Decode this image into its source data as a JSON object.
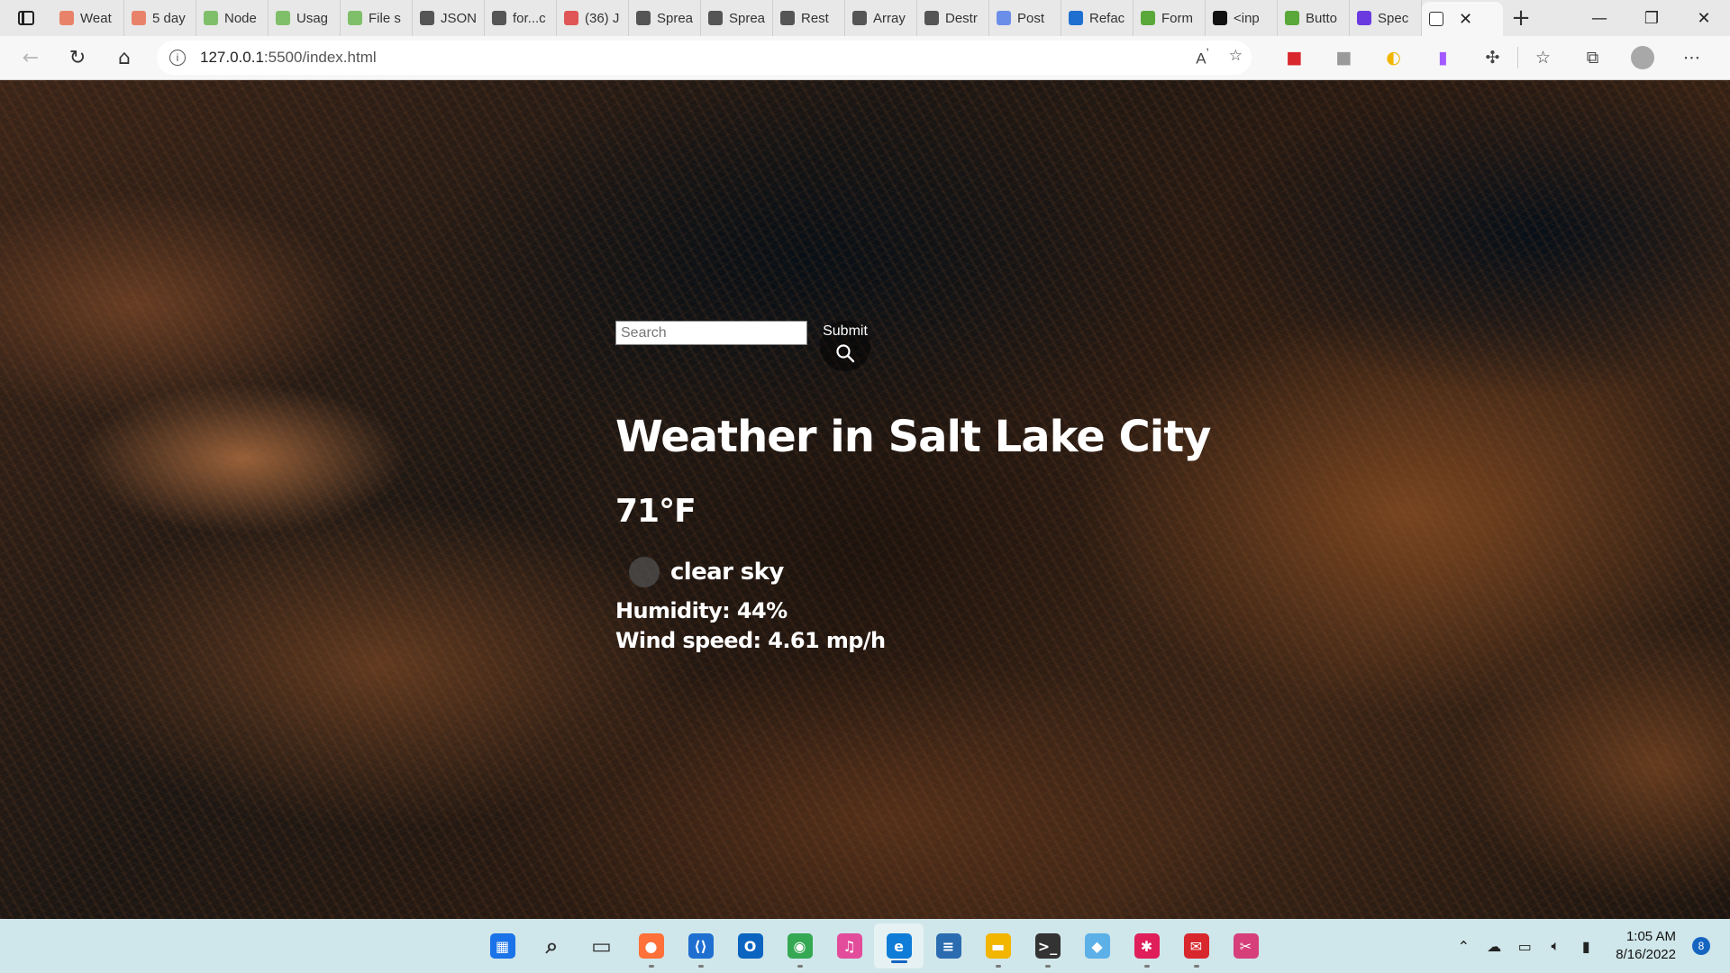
{
  "browser": {
    "tabs": [
      {
        "label": "Weat",
        "icon": "openweather-icon",
        "color": "#e8836a"
      },
      {
        "label": "5 day",
        "icon": "openweather-icon",
        "color": "#e8836a"
      },
      {
        "label": "Node",
        "icon": "nodejs-icon",
        "color": "#7fbf6a"
      },
      {
        "label": "Usag",
        "icon": "nodejs-icon",
        "color": "#7fbf6a"
      },
      {
        "label": "File s",
        "icon": "nodejs-icon",
        "color": "#7fbf6a"
      },
      {
        "label": "JSON",
        "icon": "mdn-icon",
        "color": "#555555"
      },
      {
        "label": "for...c",
        "icon": "mdn-icon",
        "color": "#555555"
      },
      {
        "label": "(36) J",
        "icon": "youtube-icon",
        "color": "#e05555"
      },
      {
        "label": "Sprea",
        "icon": "mdn-icon",
        "color": "#555555"
      },
      {
        "label": "Sprea",
        "icon": "mdn-icon",
        "color": "#555555"
      },
      {
        "label": "Rest",
        "icon": "mdn-icon",
        "color": "#555555"
      },
      {
        "label": "Array",
        "icon": "mdn-icon",
        "color": "#555555"
      },
      {
        "label": "Destr",
        "icon": "mdn-icon",
        "color": "#555555"
      },
      {
        "label": "Post",
        "icon": "zoom-icon",
        "color": "#6b8ee8"
      },
      {
        "label": "Refac",
        "icon": "vscode-icon",
        "color": "#1f6fd1"
      },
      {
        "label": "Form",
        "icon": "green-leaf-icon",
        "color": "#5aa83a"
      },
      {
        "label": "<inp",
        "icon": "mdn-icon",
        "color": "#111111"
      },
      {
        "label": "Butto",
        "icon": "green-leaf-icon",
        "color": "#5aa83a"
      },
      {
        "label": "Spec",
        "icon": "purple-icon",
        "color": "#6a3ae0"
      },
      {
        "label": "",
        "icon": "page-icon",
        "color": "#ffffff",
        "active": true
      }
    ],
    "window_controls": {
      "minimize": "—",
      "restore": "❐",
      "close": "✕"
    },
    "url_host": "127.0.0.1",
    "url_path": ":5500/index.html"
  },
  "page": {
    "search": {
      "placeholder": "Search",
      "value": ""
    },
    "submit_label": "Submit",
    "title": "Weather in Salt Lake City",
    "temperature": "71°F",
    "description": "clear sky",
    "humidity": "Humidity: 44%",
    "wind": "Wind speed: 4.61 mp/h"
  },
  "taskbar": {
    "apps": [
      {
        "name": "start-icon",
        "color": "#1a73e8",
        "glyph": "▦"
      },
      {
        "name": "search-icon",
        "color": "#333333",
        "glyph": "⌕"
      },
      {
        "name": "task-view-icon",
        "color": "#333333",
        "glyph": "▭"
      },
      {
        "name": "firefox-icon",
        "color": "#ff7139",
        "glyph": "●"
      },
      {
        "name": "vscode-icon",
        "color": "#1f6fd1",
        "glyph": "⟨⟩"
      },
      {
        "name": "outlook-icon",
        "color": "#0a64c0",
        "glyph": "O"
      },
      {
        "name": "chrome-icon",
        "color": "#34a853",
        "glyph": "◉"
      },
      {
        "name": "itunes-icon",
        "color": "#e24c9b",
        "glyph": "♫"
      },
      {
        "name": "edge-icon",
        "color": "#0f7cd8",
        "glyph": "e"
      },
      {
        "name": "notepad-icon",
        "color": "#2b6cb0",
        "glyph": "≡"
      },
      {
        "name": "file-explorer-icon",
        "color": "#f2b500",
        "glyph": "▬"
      },
      {
        "name": "terminal-icon",
        "color": "#333333",
        "glyph": ">_"
      },
      {
        "name": "git-icon",
        "color": "#5cb0e8",
        "glyph": "◆"
      },
      {
        "name": "slack-icon",
        "color": "#e01e5a",
        "glyph": "✱"
      },
      {
        "name": "postman-icon",
        "color": "#d9272e",
        "glyph": "✉"
      },
      {
        "name": "snipping-tool-icon",
        "color": "#d63f7a",
        "glyph": "✂"
      }
    ],
    "time": "1:05 AM",
    "date": "8/16/2022",
    "notifications": "8"
  }
}
